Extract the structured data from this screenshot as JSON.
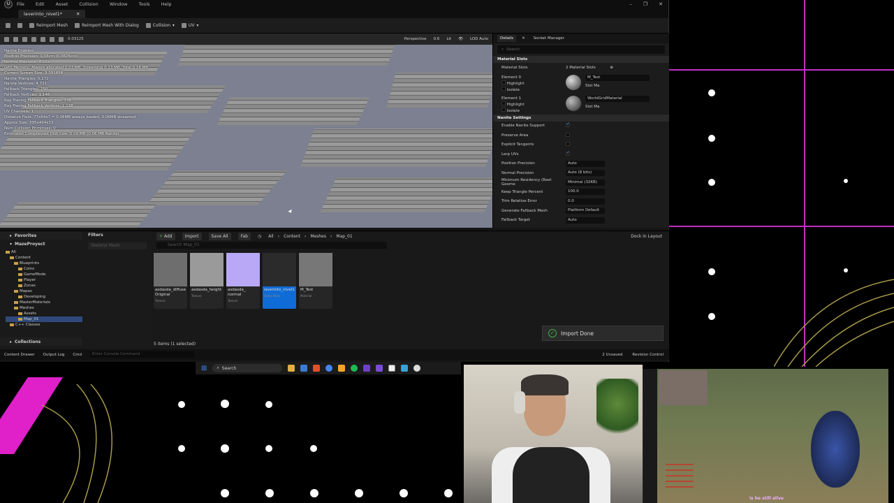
{
  "app": {
    "menu": [
      "File",
      "Edit",
      "Asset",
      "Collision",
      "Window",
      "Tools",
      "Help"
    ],
    "window_controls": [
      "–",
      "❐",
      "✕"
    ],
    "tab_title": "laverinto_nivel1*"
  },
  "toolbar": {
    "reimport": "Reimport Mesh",
    "reimport_dialog": "Reimport Mesh With Dialog",
    "collision": "Collision",
    "uv": "UV"
  },
  "viewport_toolbar": {
    "snap_value": "0.03125",
    "perspective": "Perspective",
    "speed": "0.6",
    "lit": "Lit",
    "lod": "LOD Auto"
  },
  "viewport_stats": [
    "Nanite Enabled",
    "Position Precision: 1/16cm (0.0625cm)",
    "Normal Precision: 8 bits",
    "GPU Memory: Always allocated 0.03 MB, Streaming 0.13 MB, Total 0.16 MB",
    "Current Screen Size: 3.391858",
    "Nanite Triangles: 5,172",
    "Nanite Vertices: 4,721",
    "Fallback Triangles: 750",
    "Fallback Vertices: 1,146",
    "Ray Tracing Fallback Triangles: 748",
    "Ray Tracing Fallback Vertices: 1,138",
    "UV Channels: 1",
    "Distance Field: 77x64x7 = 0.06MB always loaded, 0.06MB streamed",
    "Approx Size: 395x404x13",
    "Num Collision Primitives: 0",
    "Estimated Compressed Disk Size: 0.09 MB (0.06 MB Nanite)"
  ],
  "details": {
    "tab_details": "Details",
    "tab_socket": "Socket Manager",
    "search_placeholder": "Search",
    "section_material": "Material Slots",
    "material_slots_label": "Material Slots",
    "material_slots_value": "2 Material Slots",
    "element0": "Element 0",
    "element1": "Element 1",
    "highlight": "Highlight",
    "isolate": "Isolate",
    "mat0": "M_Test",
    "mat1": "WorldGridMaterial",
    "slot": "Slot",
    "ma": "Ma",
    "section_nanite": "Nanite Settings",
    "rows": [
      {
        "label": "Enable Nanite Support",
        "kind": "check",
        "value": true
      },
      {
        "label": "Preserve Area",
        "kind": "check",
        "value": false
      },
      {
        "label": "Explicit Tangents",
        "kind": "check",
        "value": false
      },
      {
        "label": "Lerp UVs",
        "kind": "check",
        "value": true
      },
      {
        "label": "Position Precision",
        "kind": "drop",
        "value": "Auto"
      },
      {
        "label": "Normal Precision",
        "kind": "drop",
        "value": "Auto (8 bits)"
      },
      {
        "label": "Minimum Residency (Root Geome",
        "kind": "drop",
        "value": "Minimal (32KB)"
      },
      {
        "label": "Keep Triangle Percent",
        "kind": "drop",
        "value": "100.0"
      },
      {
        "label": "Trim Relative Error",
        "kind": "drop",
        "value": "0.0"
      },
      {
        "label": "Generate Fallback Mesh",
        "kind": "drop",
        "value": "Platform Default"
      },
      {
        "label": "Fallback Target",
        "kind": "drop",
        "value": "Auto"
      }
    ]
  },
  "content_browser": {
    "favorites": "Favorites",
    "project": "MazeProyect",
    "filters": "Filters",
    "filter_item": "Skeletal Mesh",
    "add": "Add",
    "import": "Import",
    "save_all": "Save All",
    "fab": "Fab",
    "path": [
      "All",
      "Content",
      "Meshes",
      "Map_01"
    ],
    "search_placeholder": "Search Map_01",
    "dock": "Dock in Layout",
    "tree": [
      {
        "label": "All",
        "indent": 0
      },
      {
        "label": "Content",
        "indent": 1
      },
      {
        "label": "Blueprints",
        "indent": 2
      },
      {
        "label": "Coins",
        "indent": 3
      },
      {
        "label": "GameMode",
        "indent": 3
      },
      {
        "label": "Player",
        "indent": 3
      },
      {
        "label": "Zonas",
        "indent": 3
      },
      {
        "label": "Mapas",
        "indent": 2
      },
      {
        "label": "Developing",
        "indent": 3
      },
      {
        "label": "MasterMaterials",
        "indent": 2
      },
      {
        "label": "Meshes",
        "indent": 2
      },
      {
        "label": "Assets",
        "indent": 3
      },
      {
        "label": "Map_01",
        "indent": 3
      },
      {
        "label": "C++ Classes",
        "indent": 1
      }
    ],
    "selected_tree_index": 12,
    "assets": [
      {
        "name": "asdasda_diffuse Original",
        "type": "Texture",
        "thumb": "#6e6e6e"
      },
      {
        "name": "asdasda_height",
        "type": "Texture",
        "thumb": "#9a9a9a"
      },
      {
        "name": "asdasda_ normal",
        "type": "Texture",
        "thumb": "#b9a8f5"
      },
      {
        "name": "laverinto_nivel1",
        "type": "Static Mesh",
        "thumb": "#2b2b2b"
      },
      {
        "name": "M_Test",
        "type": "Material",
        "thumb": "#777"
      }
    ],
    "selected_asset_index": 3,
    "collections": "Collections",
    "count": "5 items (1 selected)",
    "toast": "Import Done"
  },
  "statusbar": {
    "content_drawer": "Content Drawer",
    "output_log": "Output Log",
    "cmd": "Cmd",
    "cmd_placeholder": "Enter Console Command",
    "unsaved": "2 Unsaved",
    "revision": "Revision Control"
  },
  "taskbar": {
    "search": "Search"
  },
  "game": {
    "subtitle": "is he still alive"
  }
}
